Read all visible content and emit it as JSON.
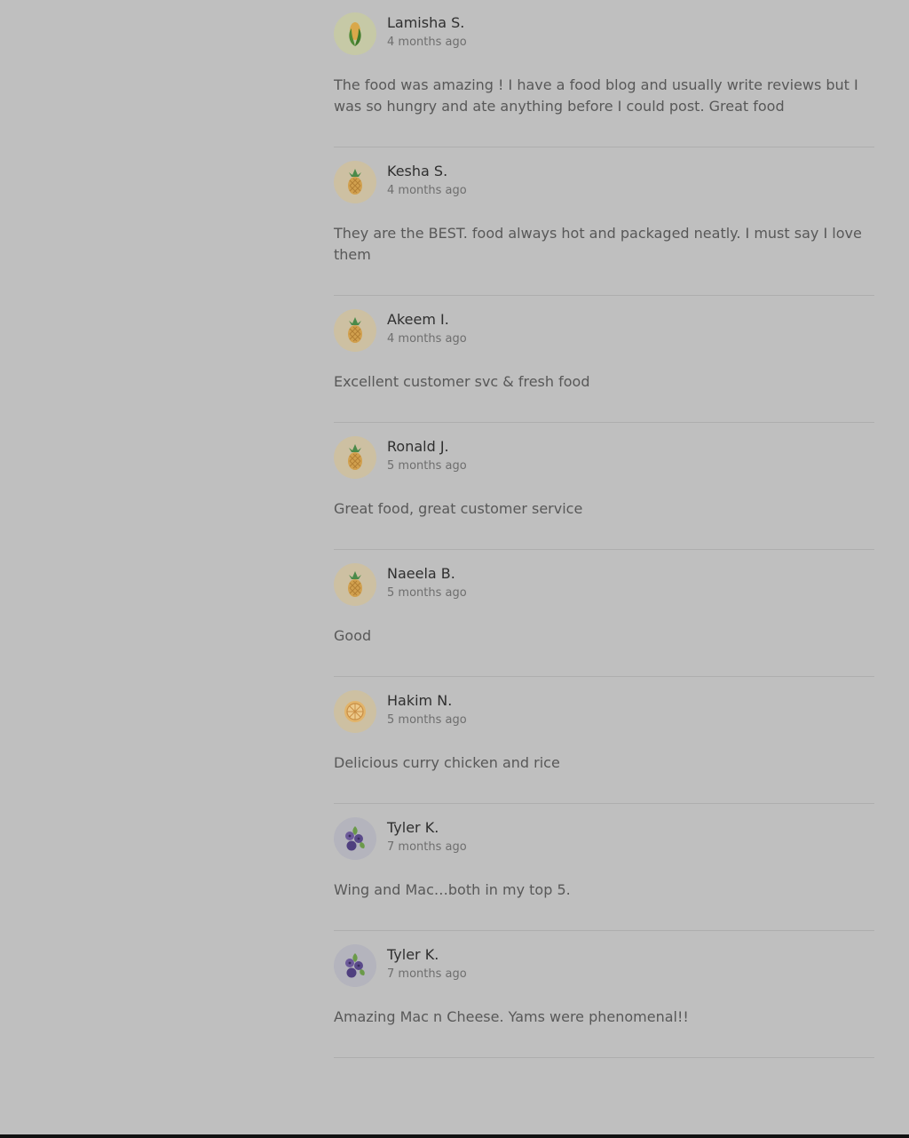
{
  "reviews": [
    {
      "name": "Lamisha S.",
      "time": "4 months ago",
      "text": "The food was amazing ! I have a food blog and usually write reviews but I was so hungry and ate anything before I could post. Great food",
      "avatar": "corn-icon",
      "avatar_bg": "#c6c9a6"
    },
    {
      "name": "Kesha S.",
      "time": "4 months ago",
      "text": "They are the BEST. food always hot and packaged neatly. I must say I love them",
      "avatar": "pineapple-icon",
      "avatar_bg": "#cdc0a2"
    },
    {
      "name": "Akeem I.",
      "time": "4 months ago",
      "text": "Excellent customer svc & fresh food",
      "avatar": "pineapple-icon",
      "avatar_bg": "#cdc0a2"
    },
    {
      "name": "Ronald J.",
      "time": "5 months ago",
      "text": "Great food, great customer service",
      "avatar": "pineapple-icon",
      "avatar_bg": "#cdc0a2"
    },
    {
      "name": "Naeela B.",
      "time": "5 months ago",
      "text": "Good",
      "avatar": "pineapple-icon",
      "avatar_bg": "#cdc0a2"
    },
    {
      "name": "Hakim N.",
      "time": "5 months ago",
      "text": "Delicious curry chicken and rice",
      "avatar": "orange-slice-icon",
      "avatar_bg": "#cdc0a2"
    },
    {
      "name": "Tyler K.",
      "time": "7 months ago",
      "text": "Wing and Mac…both in my top 5.",
      "avatar": "blueberry-icon",
      "avatar_bg": "#b4b4bd"
    },
    {
      "name": "Tyler K.",
      "time": "7 months ago",
      "text": "Amazing Mac n Cheese. Yams were phenomenal!!",
      "avatar": "blueberry-icon",
      "avatar_bg": "#b4b4bd"
    }
  ]
}
